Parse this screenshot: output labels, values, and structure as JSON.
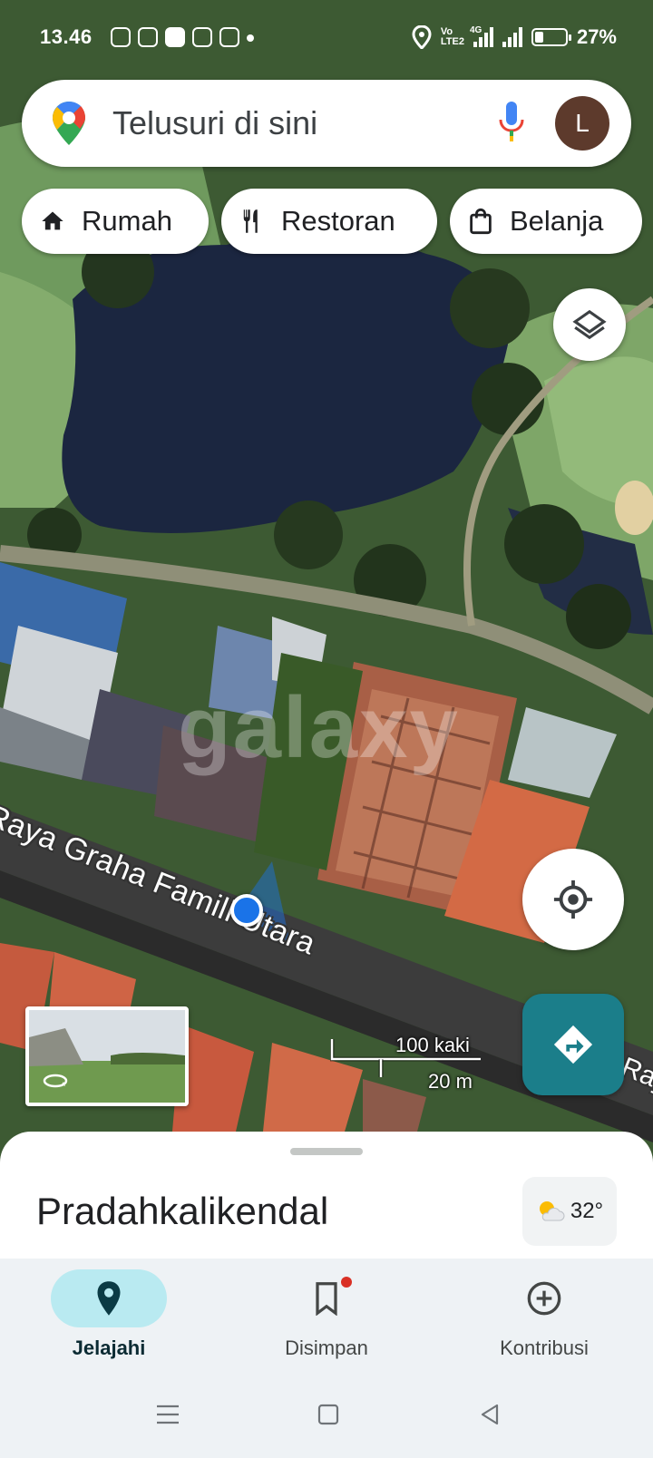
{
  "status_bar": {
    "time": "13.46",
    "network_label_top": "Vo",
    "network_label_bottom": "LTE2",
    "network_type": "4G",
    "battery_percent": "27%",
    "battery_level": 0.27
  },
  "search": {
    "placeholder": "Telusuri di sini",
    "avatar_initial": "L"
  },
  "chips": [
    {
      "label": "Rumah",
      "icon": "home-icon"
    },
    {
      "label": "Restoran",
      "icon": "restaurant-icon"
    },
    {
      "label": "Belanja",
      "icon": "shopping-bag-icon"
    }
  ],
  "map": {
    "street_name": "Raya Graha Famili Utara",
    "street_name_edge": "Raya",
    "watermark": "galaxy",
    "scale_imperial": "100 kaki",
    "scale_metric": "20 m"
  },
  "place": {
    "title": "Pradahkalikendal",
    "weather_temp": "32°",
    "weather_icon": "partly-sunny-icon"
  },
  "nav": {
    "items": [
      {
        "label": "Jelajahi",
        "icon": "explore-pin-icon",
        "active": true
      },
      {
        "label": "Disimpan",
        "icon": "bookmark-icon",
        "active": false
      },
      {
        "label": "Kontribusi",
        "icon": "add-circle-icon",
        "active": false
      }
    ]
  },
  "colors": {
    "accent": "#1b7e8a",
    "active_pill": "#b9eaf1",
    "location_blue": "#1a73e8",
    "notification_dot": "#d93025"
  }
}
